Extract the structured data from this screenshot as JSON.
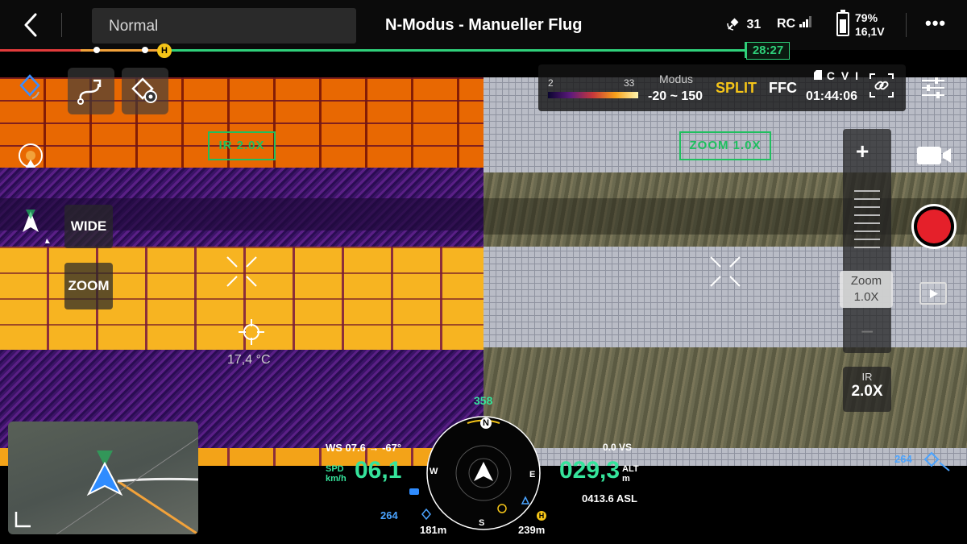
{
  "topbar": {
    "mode_value": "Normal",
    "title": "N-Modus - Manueller Flug",
    "satellites": "31",
    "rc_label": "RC",
    "battery_percent": "79%",
    "battery_voltage": "16,1V",
    "battery_level": 0.79,
    "more_label": "•••"
  },
  "timeline": {
    "home_label": "H",
    "remaining_time": "28:27"
  },
  "thermal": {
    "scale_min": "2",
    "scale_max": "33",
    "modus_label": "Modus",
    "range": "-20 ~ 150",
    "split_label": "SPLIT",
    "ffc_label": "FFC",
    "storage_label": "C V I",
    "rec_time": "01:44:06"
  },
  "ir_view": {
    "zoom_label": "IR  2.0X",
    "spot_temp": "17,4 °C"
  },
  "visual_view": {
    "zoom_label": "ZOOM  1.0X"
  },
  "left_tools": {
    "wide_label": "WIDE",
    "zoom_label": "ZOOM"
  },
  "zoom_control": {
    "plus": "+",
    "minus": "−",
    "zoom_title": "Zoom",
    "zoom_value": "1.0X",
    "ir_title": "IR",
    "ir_value": "2.0X"
  },
  "hud": {
    "wind": "WS 07.6 → -67°",
    "spd_label": "SPD",
    "spd_unit": "km/h",
    "speed": "06,1",
    "altitude": "029,3",
    "alt_label": "ALT",
    "alt_unit": "m",
    "vs": "0.0  VS",
    "asl": "0413.6 ASL",
    "heading": "358",
    "home_distance_left": "264",
    "home_distance_right": "264",
    "dist_a": "181m",
    "dist_b": "239m",
    "compass_n": "N",
    "compass_e": "E",
    "compass_s": "S",
    "compass_w": "W",
    "home_label": "H"
  },
  "colors": {
    "accent_green": "#35e39b",
    "split_yellow": "#f5c518",
    "record_red": "#e5202a",
    "zoom_box_green": "#1fbf5f"
  }
}
